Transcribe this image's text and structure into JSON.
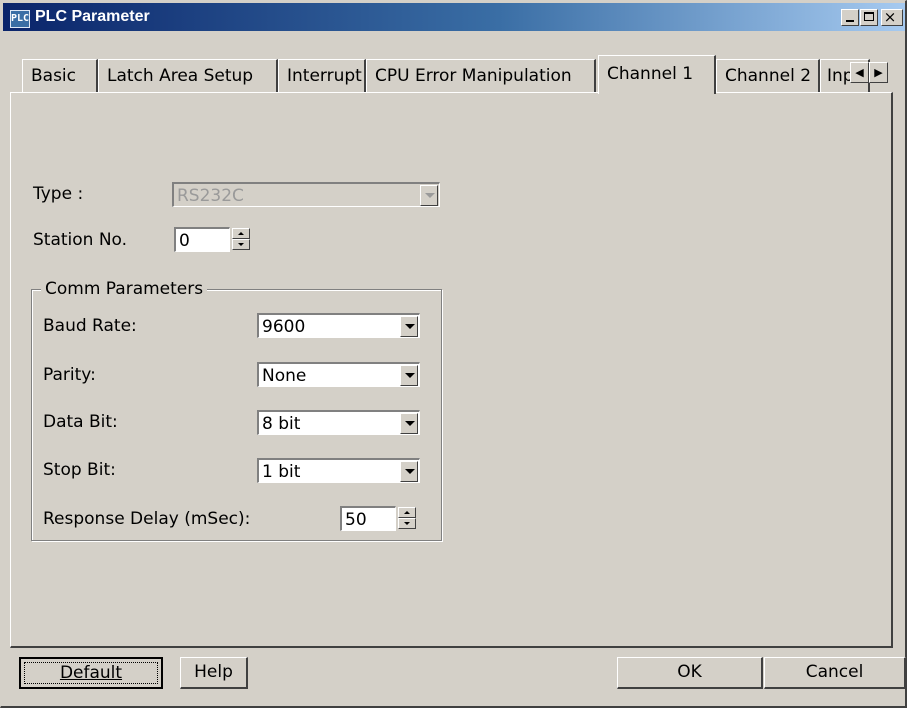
{
  "window": {
    "title": "PLC Parameter",
    "app_icon_text": "PLC",
    "controls": {
      "minimize": "minimize",
      "maximize": "maximize",
      "close": "×"
    }
  },
  "tabs": [
    {
      "label": "Basic"
    },
    {
      "label": "Latch Area Setup"
    },
    {
      "label": "Interrupt"
    },
    {
      "label": "CPU Error Manipulation"
    },
    {
      "label": "Channel 1",
      "active": true
    },
    {
      "label": "Channel 2"
    },
    {
      "label": "Inp"
    }
  ],
  "tab_scroll": {
    "left": "◀",
    "right": "▶"
  },
  "channel": {
    "type_label": "Type :",
    "type_value": "RS232C",
    "station_label": "Station No.",
    "station_value": "0"
  },
  "comm": {
    "group_label": "Comm Parameters",
    "baud_label": "Baud Rate:",
    "baud_value": "9600",
    "parity_label": "Parity:",
    "parity_value": "None",
    "databit_label": "Data Bit:",
    "databit_value": "8 bit",
    "stopbit_label": "Stop Bit:",
    "stopbit_value": "1 bit",
    "delay_label": "Response Delay (mSec):",
    "delay_value": "50"
  },
  "buttons": {
    "default": "Default",
    "help": "Help",
    "ok": "OK",
    "cancel": "Cancel"
  },
  "colors": {
    "face": "#d4d0c8",
    "title_start": "#0a246a",
    "title_end": "#a6caf0",
    "disabled_text": "#9a9a9a"
  }
}
